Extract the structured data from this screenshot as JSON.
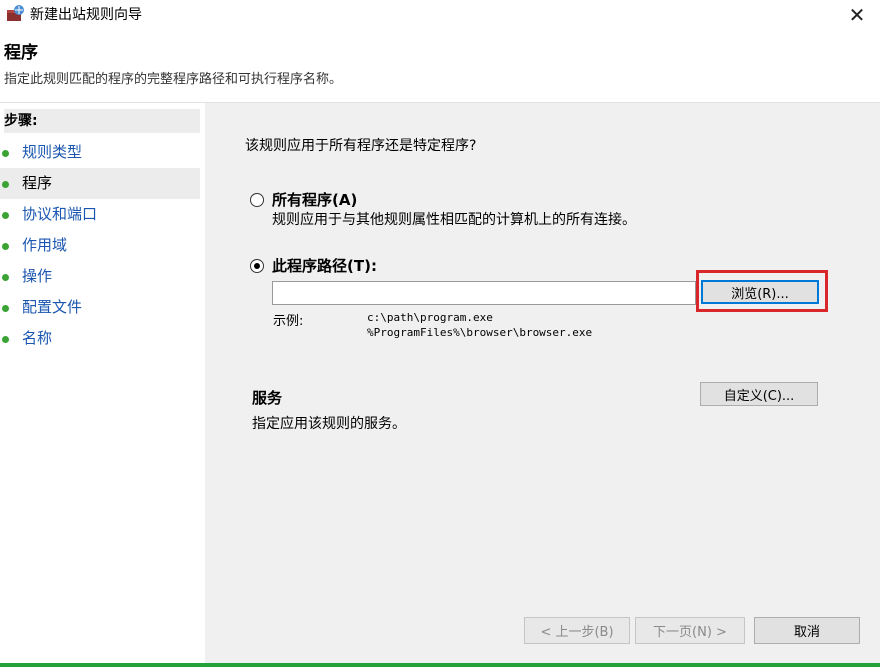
{
  "window": {
    "title": "新建出站规则向导",
    "close_glyph": "✕"
  },
  "header": {
    "title": "程序",
    "subtitle": "指定此规则匹配的程序的完整程序路径和可执行程序名称。"
  },
  "sidebar": {
    "steps_label": "步骤:",
    "items": [
      {
        "label": "规则类型",
        "active": false
      },
      {
        "label": "程序",
        "active": true
      },
      {
        "label": "协议和端口",
        "active": false
      },
      {
        "label": "作用域",
        "active": false
      },
      {
        "label": "操作",
        "active": false
      },
      {
        "label": "配置文件",
        "active": false
      },
      {
        "label": "名称",
        "active": false
      }
    ]
  },
  "main": {
    "question": "该规则应用于所有程序还是特定程序?",
    "option_all": {
      "label": "所有程序(A)",
      "description": "规则应用于与其他规则属性相匹配的计算机上的所有连接。",
      "checked": false
    },
    "option_path": {
      "label": "此程序路径(T):",
      "checked": true
    },
    "path_input": {
      "value": "",
      "placeholder": ""
    },
    "browse_button": "浏览(R)...",
    "example_label": "示例:",
    "example_lines": [
      "c:\\path\\program.exe",
      "%ProgramFiles%\\browser\\browser.exe"
    ],
    "services": {
      "title": "服务",
      "description": "指定应用该规则的服务。",
      "customize_button": "自定义(C)..."
    }
  },
  "footer": {
    "back_button": "< 上一步(B)",
    "next_button": "下一页(N) >",
    "cancel_button": "取消"
  },
  "colors": {
    "highlight": "#d9262a",
    "link_blue": "#1a56b0",
    "step_dot": "#3aa334",
    "focus_blue": "#0078d7"
  }
}
